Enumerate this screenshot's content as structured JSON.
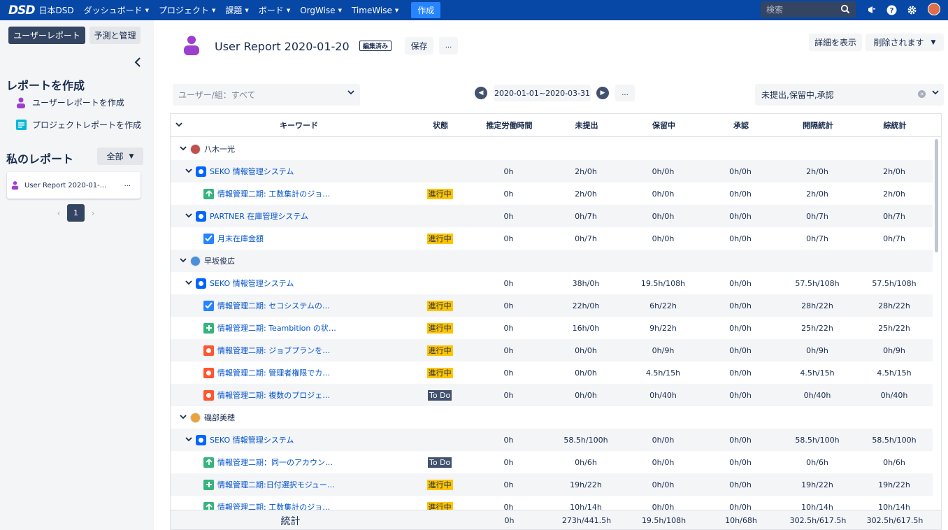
{
  "nav": {
    "logo": "DSD",
    "org": "日本DSD",
    "items": [
      "ダッシュボード",
      "プロジェクト",
      "課題",
      "ボード",
      "OrgWise",
      "TimeWise"
    ],
    "create": "作成",
    "search_placeholder": "検索"
  },
  "sidebar": {
    "tab_report": "ユーザーレポート",
    "tab_forecast": "予測と管理",
    "create_heading": "レポートを作成",
    "create_user_report": "ユーザーレポートを作成",
    "create_project_report": "プロジェクトレポートを作成",
    "my_reports_heading": "私のレポート",
    "filter_all": "全部",
    "report_card": "User Report 2020-01-...",
    "report_more": "...",
    "page": "1"
  },
  "header": {
    "title": "User Report 2020-01-20",
    "edited_badge": "編集済み",
    "save": "保存",
    "more": "...",
    "show_details": "詳細を表示",
    "delete": "削除されます"
  },
  "filters": {
    "user_group": "ユーザー/組：すべて",
    "date_range": "2020-01-01~2020-03-31",
    "date_more": "...",
    "status": "未提出,保留中,承認"
  },
  "columns": [
    "キーワード",
    "状態",
    "推定労働時間",
    "未提出",
    "保留中",
    "承認",
    "開隔統計",
    "綜統計"
  ],
  "rows": [
    {
      "level": 0,
      "kind": "user",
      "label": "八木一光",
      "status": "",
      "values": [
        "",
        "",
        "",
        "",
        "",
        ""
      ],
      "avatar": "#c0504d"
    },
    {
      "level": 1,
      "kind": "project",
      "label": "SEKO 情報管理システム",
      "status": "",
      "values": [
        "0h",
        "2h/0h",
        "0h/0h",
        "0h/0h",
        "2h/0h",
        "2h/0h"
      ]
    },
    {
      "level": 2,
      "kind": "task",
      "icon": "story",
      "label": "情報管理二期: 工数集計のジョ…",
      "status": "進行中",
      "status_type": "inprog",
      "values": [
        "0h",
        "2h/0h",
        "0h/0h",
        "0h/0h",
        "2h/0h",
        "2h/0h"
      ]
    },
    {
      "level": 1,
      "kind": "project",
      "label": "PARTNER 在庫管理システム",
      "status": "",
      "values": [
        "0h",
        "0h/7h",
        "0h/0h",
        "0h/0h",
        "0h/7h",
        "0h/7h"
      ]
    },
    {
      "level": 2,
      "kind": "task",
      "icon": "task",
      "label": "月末在庫金額",
      "status": "進行中",
      "status_type": "inprog",
      "values": [
        "0h",
        "0h/7h",
        "0h/0h",
        "0h/0h",
        "0h/7h",
        "0h/7h"
      ]
    },
    {
      "level": 0,
      "kind": "user",
      "label": "早坂俊広",
      "status": "",
      "values": [
        "",
        "",
        "",
        "",
        "",
        ""
      ],
      "avatar": "#4a90d9"
    },
    {
      "level": 1,
      "kind": "project",
      "label": "SEKO 情報管理システム",
      "status": "",
      "values": [
        "0h",
        "38h/0h",
        "19.5h/108h",
        "0h/0h",
        "57.5h/108h",
        "57.5h/108h"
      ]
    },
    {
      "level": 2,
      "kind": "task",
      "icon": "task",
      "label": "情報管理二期: セコシステムの…",
      "status": "進行中",
      "status_type": "inprog",
      "values": [
        "0h",
        "22h/0h",
        "6h/22h",
        "0h/0h",
        "28h/22h",
        "28h/22h"
      ]
    },
    {
      "level": 2,
      "kind": "task",
      "icon": "new",
      "label": "情報管理二期: Teambition の状…",
      "status": "進行中",
      "status_type": "inprog",
      "values": [
        "0h",
        "16h/0h",
        "9h/22h",
        "0h/0h",
        "25h/22h",
        "25h/22h"
      ]
    },
    {
      "level": 2,
      "kind": "task",
      "icon": "bug",
      "label": "情報管理二期: ジョブプランを…",
      "status": "進行中",
      "status_type": "inprog",
      "values": [
        "0h",
        "0h/0h",
        "0h/9h",
        "0h/0h",
        "0h/9h",
        "0h/9h"
      ]
    },
    {
      "level": 2,
      "kind": "task",
      "icon": "bug",
      "label": "情報管理二期: 管理者権限でカ…",
      "status": "進行中",
      "status_type": "inprog",
      "values": [
        "0h",
        "0h/0h",
        "4.5h/15h",
        "0h/0h",
        "4.5h/15h",
        "4.5h/15h"
      ]
    },
    {
      "level": 2,
      "kind": "task",
      "icon": "bug",
      "label": "情報管理二期: 複数のプロジェ…",
      "status": "To Do",
      "status_type": "todo",
      "values": [
        "0h",
        "0h/0h",
        "0h/40h",
        "0h/0h",
        "0h/40h",
        "0h/40h"
      ]
    },
    {
      "level": 0,
      "kind": "user",
      "label": "磯部美穂",
      "status": "",
      "values": [
        "",
        "",
        "",
        "",
        "",
        ""
      ],
      "avatar": "#e8a33c"
    },
    {
      "level": 1,
      "kind": "project",
      "label": "SEKO 情報管理システム",
      "status": "",
      "values": [
        "0h",
        "58.5h/100h",
        "0h/0h",
        "0h/0h",
        "58.5h/100h",
        "58.5h/100h"
      ]
    },
    {
      "level": 2,
      "kind": "task",
      "icon": "story",
      "label": "情報管理二期：同一のアカウン…",
      "status": "To Do",
      "status_type": "todo",
      "values": [
        "0h",
        "0h/6h",
        "0h/0h",
        "0h/0h",
        "0h/6h",
        "0h/6h"
      ]
    },
    {
      "level": 2,
      "kind": "task",
      "icon": "new",
      "label": "情報管理二期:日付選択モジュー…",
      "status": "進行中",
      "status_type": "inprog",
      "values": [
        "0h",
        "19h/22h",
        "0h/0h",
        "0h/0h",
        "19h/22h",
        "19h/22h"
      ]
    },
    {
      "level": 2,
      "kind": "task",
      "icon": "story",
      "label": "情報管理二期: 工数集計のジョ…",
      "status": "進行中",
      "status_type": "inprog",
      "values": [
        "0h",
        "10h/14h",
        "0h/0h",
        "0h/0h",
        "10h/14h",
        "10h/14h"
      ]
    }
  ],
  "totals": {
    "label": "統計",
    "values": [
      "0h",
      "273h/441.5h",
      "19.5h/108h",
      "10h/68h",
      "302.5h/617.5h",
      "302.5h/617.5h"
    ]
  },
  "colors": {
    "nav": "#0747a6",
    "in_progress": "#ffc400",
    "todo": "#42526e",
    "story": "#36b37e",
    "task": "#2684ff",
    "bug": "#ff5630"
  }
}
